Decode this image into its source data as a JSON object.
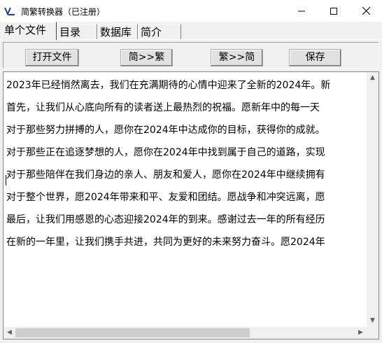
{
  "window": {
    "title": "简繁转换器（已注册）",
    "icon": "app-logo-icon",
    "controls": [
      "minimize-icon",
      "maximize-icon",
      "close-icon"
    ]
  },
  "tabs": [
    {
      "label": "单个文件",
      "active": true
    },
    {
      "label": "目录",
      "active": false
    },
    {
      "label": "数据库",
      "active": false
    },
    {
      "label": "简介",
      "active": false
    }
  ],
  "toolbar": {
    "open_file": "打开文件",
    "to_traditional": "简>>繁",
    "to_simplified": "繁>>简",
    "save": "保存"
  },
  "editor": {
    "lines": [
      "2023年已经悄然离去，我们在充满期待的心情中迎来了全新的2024年。新",
      "首先，让我们从心底向所有的读者送上最热烈的祝福。愿新年中的每一天",
      "对于那些努力拼搏的人，愿你在2024年中达成你的目标，获得你的成就。",
      "对于那些正在追逐梦想的人，愿你在2024年中找到属于自己的道路，实现",
      "对于那些陪伴在我们身边的亲人、朋友和爱人，愿你在2024年中继续拥有",
      "对于整个世界，愿2024年带来和平、友爱和团结。愿战争和冲突远离，愿",
      "最后，让我们用感恩的心态迎接2024年的到来。感谢过去一年的所有经历",
      "在新的一年里，让我们携手共进，共同为更好的未来努力奋斗。愿2024年"
    ]
  }
}
